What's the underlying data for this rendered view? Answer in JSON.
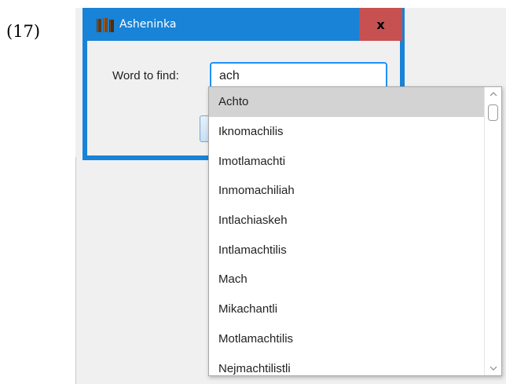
{
  "example_number": "(17)",
  "window": {
    "title": "Asheninka",
    "close_label": "x",
    "icon": "books-icon"
  },
  "form": {
    "label": "Word to find:",
    "search_value": "ach"
  },
  "dropdown": {
    "items": [
      "Achto",
      "Iknomachilis",
      "Imotlamachti",
      "Inmomachiliah",
      "Intlachiaskeh",
      "Intlamachtilis",
      "Mach",
      "Mikachantli",
      "Motlamachtilis",
      "Nejmachtilistli"
    ],
    "selected_index": 0
  },
  "colors": {
    "titlebar": "#1883d7",
    "close_button": "#c75050",
    "input_border": "#1e90ff",
    "selected_item": "#d3d3d3"
  }
}
